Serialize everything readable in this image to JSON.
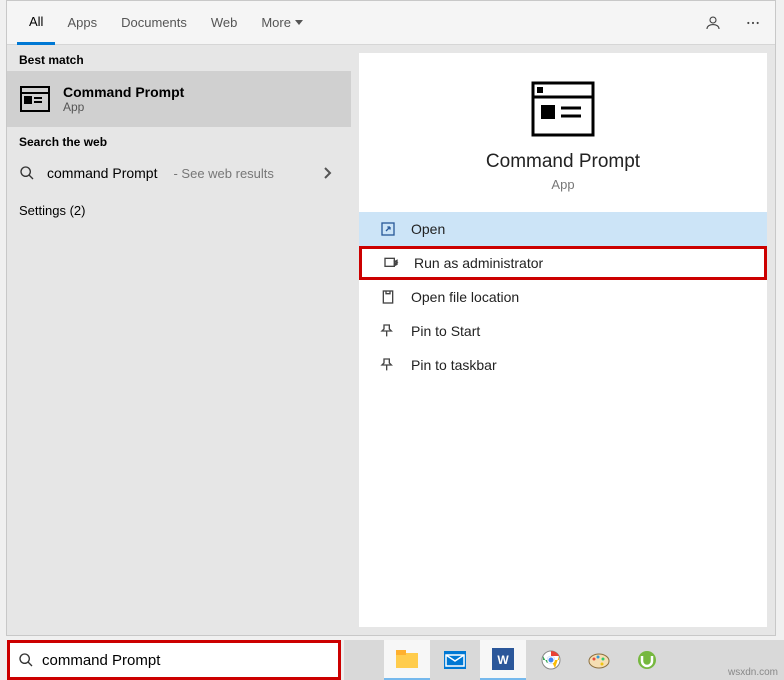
{
  "tabs": {
    "all": "All",
    "apps": "Apps",
    "documents": "Documents",
    "web": "Web",
    "more": "More"
  },
  "sections": {
    "best_match": "Best match",
    "search_web": "Search the web",
    "settings": "Settings (2)"
  },
  "best_match": {
    "title": "Command Prompt",
    "subtitle": "App"
  },
  "web_result": {
    "query": "command Prompt",
    "suffix": " - See web results"
  },
  "preview": {
    "title": "Command Prompt",
    "subtitle": "App"
  },
  "actions": {
    "open": "Open",
    "run_admin": "Run as administrator",
    "open_loc": "Open file location",
    "pin_start": "Pin to Start",
    "pin_taskbar": "Pin to taskbar"
  },
  "search": {
    "value": "command Prompt"
  },
  "watermark": "wsxdn.com"
}
